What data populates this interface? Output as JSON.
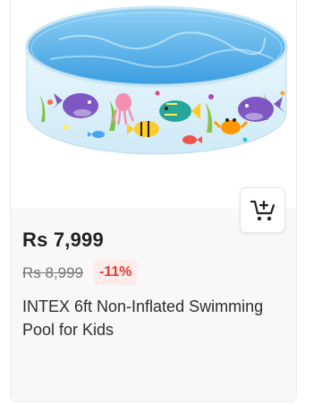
{
  "product": {
    "price": "Rs 7,999",
    "original_price": "Rs 8,999",
    "discount": "-11%",
    "title": "INTEX 6ft Non-Inflated Swimming Pool for Kids"
  },
  "icons": {
    "cart": "add-to-cart-icon",
    "image": "swimming-pool-image"
  },
  "colors": {
    "price_text": "#212121",
    "discount_text": "#e53935",
    "discount_bg": "#fdecea",
    "card_bg": "#f8f8f8"
  }
}
